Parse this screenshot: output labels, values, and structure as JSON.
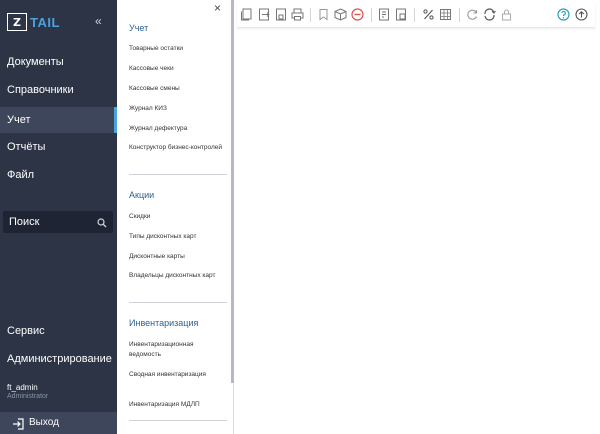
{
  "brand": {
    "logo_mark": "Z",
    "logo_text": "TAIL"
  },
  "sidebar": {
    "collapse_glyph": "«",
    "items": [
      {
        "label": "Документы",
        "active": false
      },
      {
        "label": "Справочники",
        "active": false
      },
      {
        "label": "Учет",
        "active": true
      },
      {
        "label": "Отчёты",
        "active": false
      },
      {
        "label": "Файл",
        "active": false
      }
    ],
    "search": {
      "placeholder": "Поиск",
      "icon": "search-icon"
    },
    "bottom_items": [
      {
        "label": "Сервис"
      },
      {
        "label": "Администрирование"
      }
    ],
    "user": {
      "name": "ft_admin",
      "role": "Administrator"
    },
    "logout": {
      "label": "Выход",
      "icon": "logout-icon"
    }
  },
  "flyout": {
    "close_glyph": "×",
    "sections": [
      {
        "heading": "Учет",
        "items": [
          "Товарные остатки",
          "Кассовые чеки",
          "Кассовые смены",
          "Журнал КИЗ",
          "Журнал дефектура",
          "Конструктор бизнес-контролей"
        ]
      },
      {
        "heading": "Акции",
        "items": [
          "Скидки",
          "Типы дисконтных карт",
          "Дисконтные карты",
          "Владельцы дисконтных карт"
        ]
      },
      {
        "heading": "Инвентаризация",
        "items": [
          "Инвентаризационная ведомость",
          "Сводная инвентаризация",
          "Инвентаризация МДЛП"
        ]
      }
    ]
  },
  "toolbar": {
    "icons": [
      "copy-document-icon",
      "export-document-icon",
      "save-document-icon",
      "print-icon",
      "bookmark-icon",
      "package-icon",
      "cancel-icon",
      "report-icon",
      "document-list-icon",
      "percent-icon",
      "table-icon",
      "refresh-icon",
      "sync-icon",
      "lock-icon",
      "help-icon",
      "upload-icon"
    ]
  },
  "colors": {
    "sidebar_bg": "#2c3446",
    "accent": "#4aa3e0",
    "heading_blue": "#2a6496",
    "cancel_red": "#d9534f",
    "help_teal": "#2aa0b5"
  }
}
